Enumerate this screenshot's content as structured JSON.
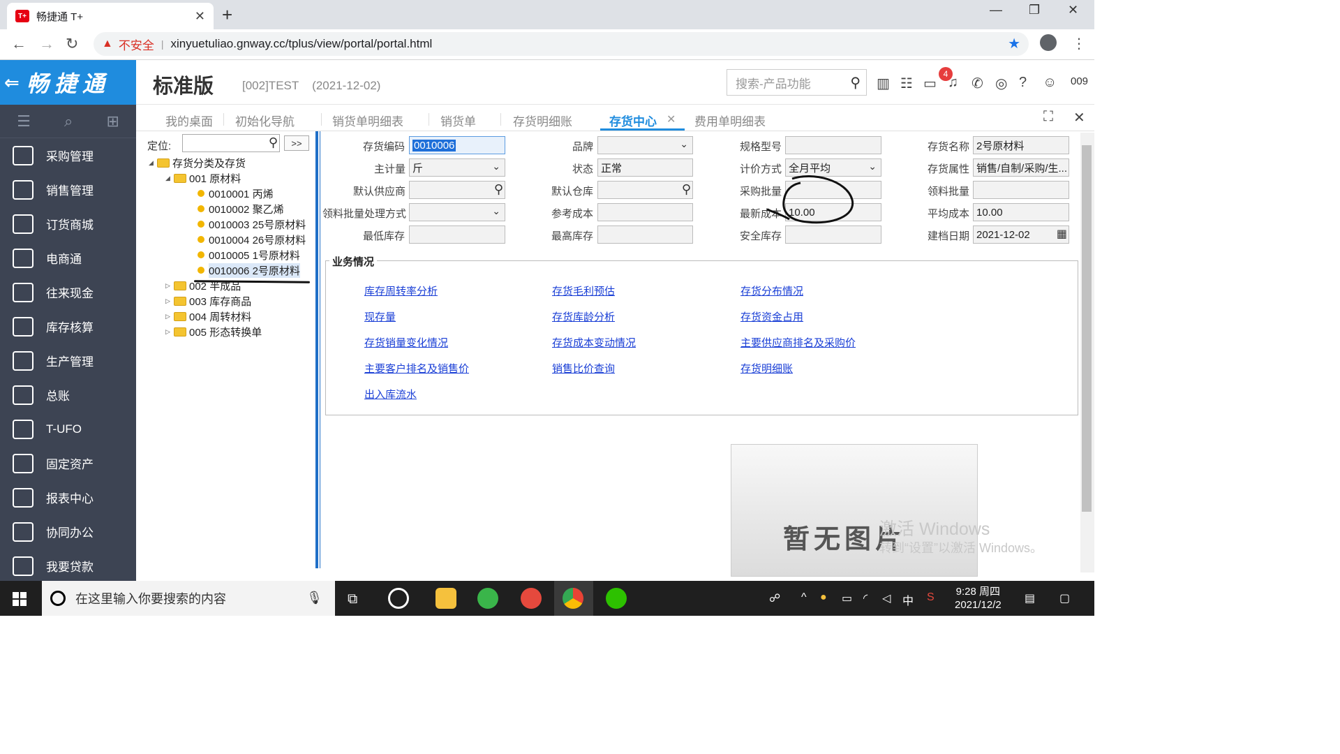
{
  "browser": {
    "tab_title": "畅捷通 T+",
    "favicon_text": "T+",
    "insecure_label": "不安全",
    "url": "xinyuetuliao.gnway.cc/tplus/view/portal/portal.html"
  },
  "header": {
    "logo_text": "畅捷通",
    "edition": "标准版",
    "account": "[002]TEST",
    "date": "(2021-12-02)",
    "search_placeholder": "搜索-产品功能",
    "notification_count": "4",
    "user_id": "009"
  },
  "sidebar": {
    "items": [
      {
        "label": "采购管理",
        "icon": "cart-icon"
      },
      {
        "label": "销售管理",
        "icon": "chart-icon"
      },
      {
        "label": "订货商城",
        "icon": "store-icon"
      },
      {
        "label": "电商通",
        "icon": "ecommerce-icon"
      },
      {
        "label": "往来现金",
        "icon": "cash-icon"
      },
      {
        "label": "库存核算",
        "icon": "inventory-icon"
      },
      {
        "label": "生产管理",
        "icon": "production-icon"
      },
      {
        "label": "总账",
        "icon": "ledger-icon"
      },
      {
        "label": "T-UFO",
        "icon": "ufo-icon"
      },
      {
        "label": "固定资产",
        "icon": "asset-icon"
      },
      {
        "label": "报表中心",
        "icon": "report-icon"
      },
      {
        "label": "协同办公",
        "icon": "office-icon"
      },
      {
        "label": "我要贷款",
        "icon": "loan-icon"
      }
    ]
  },
  "tabs": [
    "我的桌面",
    "初始化导航",
    "销货单明细表",
    "销货单",
    "存货明细账",
    "存货中心",
    "费用单明细表"
  ],
  "active_tab": "存货中心",
  "tree": {
    "locate_label": "定位:",
    "locate_button": ">>",
    "root": "存货分类及存货",
    "nodes": [
      {
        "label": "001 原材料"
      },
      {
        "label": "0010001 丙烯"
      },
      {
        "label": "0010002 聚乙烯"
      },
      {
        "label": "0010003 25号原材料"
      },
      {
        "label": "0010004 26号原材料"
      },
      {
        "label": "0010005 1号原材料"
      },
      {
        "label": "0010006 2号原材料"
      },
      {
        "label": "002 半成品"
      },
      {
        "label": "003 库存商品"
      },
      {
        "label": "004 周转材料"
      },
      {
        "label": "005 形态转换单"
      }
    ],
    "selected": "0010006 2号原材料"
  },
  "form": {
    "code_label": "存货编码",
    "code": "0010006",
    "brand_label": "品牌",
    "brand": "",
    "spec_label": "规格型号",
    "spec": "",
    "name_label": "存货名称",
    "name": "2号原材料",
    "unit_label": "主计量",
    "unit": "斤",
    "status_label": "状态",
    "status": "正常",
    "pricing_label": "计价方式",
    "pricing": "全月平均",
    "attr_label": "存货属性",
    "attr": "销售/自制/采购/生...",
    "supplier_label": "默认供应商",
    "supplier": "",
    "warehouse_label": "默认仓库",
    "warehouse": "",
    "purchase_batch_label": "采购批量",
    "purchase_batch": "",
    "pick_batch_label": "领料批量",
    "pick_batch": "",
    "pick_method_label": "领料批量处理方式",
    "pick_method": "",
    "ref_cost_label": "参考成本",
    "ref_cost": "",
    "latest_cost_label": "最新成本",
    "latest_cost": "10.00",
    "avg_cost_label": "平均成本",
    "avg_cost": "10.00",
    "min_stock_label": "最低库存",
    "min_stock": "",
    "max_stock_label": "最高库存",
    "max_stock": "",
    "safe_stock_label": "安全库存",
    "safe_stock": "",
    "created_label": "建档日期",
    "created": "2021-12-02"
  },
  "business": {
    "title": "业务情况",
    "links": [
      "库存周转率分析",
      "存货毛利预估",
      "存货分布情况",
      "现存量",
      "存货库龄分析",
      "存货资金占用",
      "存货销量变化情况",
      "存货成本变动情况",
      "主要供应商排名及采购价",
      "主要客户排名及销售价",
      "销售比价查询",
      "存货明细账",
      "出入库流水"
    ]
  },
  "picture": {
    "placeholder": "暂无图片"
  },
  "watermark": {
    "line1": "激活 Windows",
    "line2": "转到“设置”以激活 Windows。"
  },
  "taskbar": {
    "search_placeholder": "在这里输入你要搜索的内容",
    "ime": "中",
    "time": "9:28 周四",
    "date": "2021/12/2"
  },
  "colors": {
    "brand": "#1f8cde",
    "sidebar": "#3d4453",
    "link": "#1a3fd6"
  }
}
